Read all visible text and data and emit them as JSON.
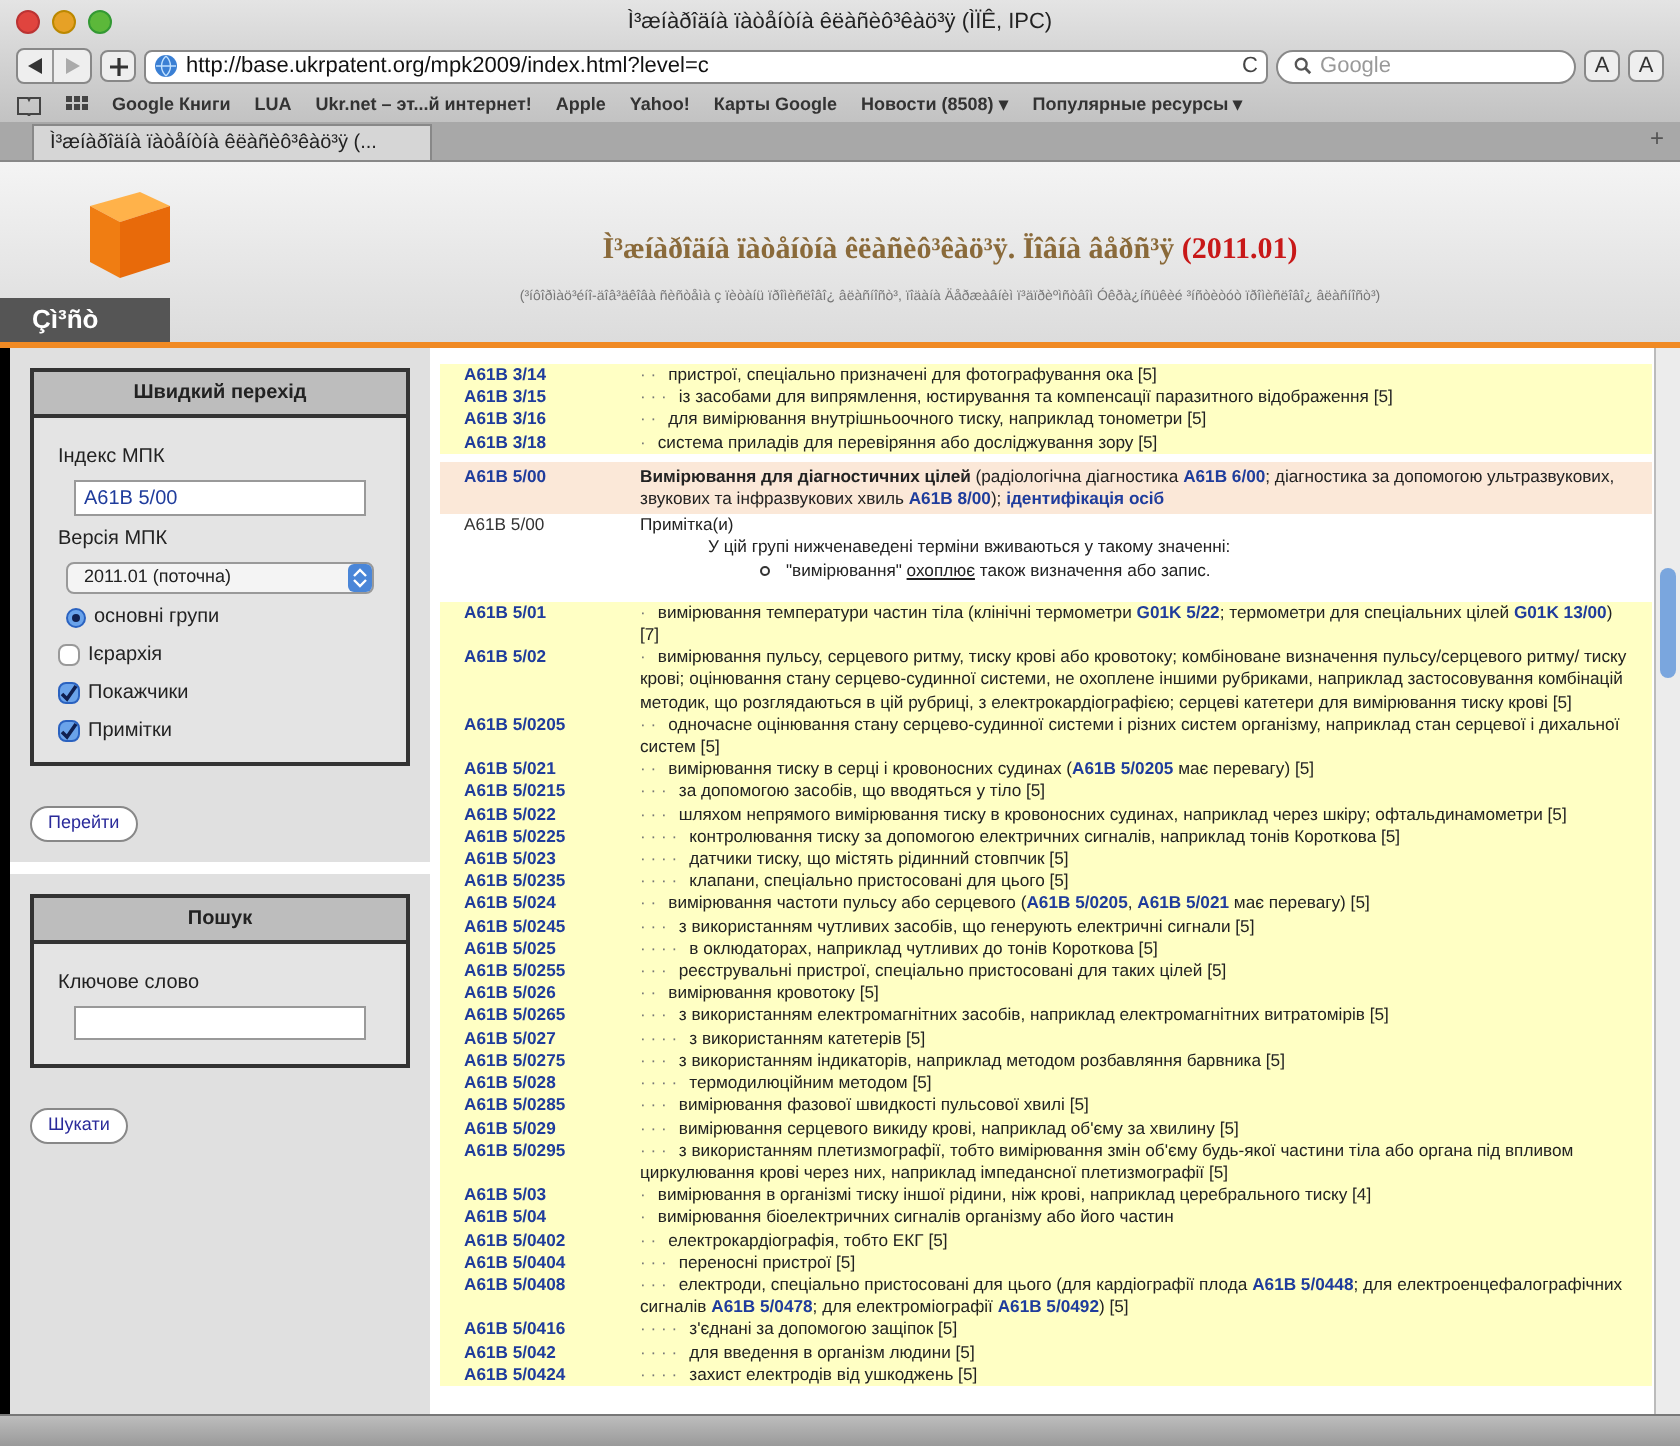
{
  "window": {
    "title": "Ì³æíàðîäíà ïàòåíòíà êëàñèô³êàö³ÿ (ÌÏÊ, IPC)"
  },
  "toolbar": {
    "url": "http://base.ukrpatent.org/mpk2009/index.html?level=c",
    "reload": "C",
    "search_placeholder": "Google",
    "text_buttons": [
      "A",
      "A"
    ]
  },
  "bookmarks": [
    "Google Книги",
    "LUA",
    "Ukr.net – эт...й интернет!",
    "Apple",
    "Yahoo!",
    "Карты Google",
    "Новости (8508) ▾",
    "Популярные ресурсы ▾"
  ],
  "tabs": [
    {
      "label": "Ì³æíàðîäíà ïàòåíòíà êëàñèô³êàö³ÿ (...",
      "selected": true
    }
  ],
  "new_tab": "+",
  "header": {
    "logo_label": "Çì³ñò",
    "title": "Ì³æíàðîäíà ïàòåíòíà êëàñèô³êàö³ÿ. Ïîâíà âåðñ³ÿ",
    "edition": "(2011.01)",
    "subtitle": "(³íôîðìàö³éíî-äîâ³äêîâà ñèñòåìà ç ïèòàíü ïðîìèñëîâî¿ âëàñíîñò³, ïîäàíà Äåðæàâíèì ï³äïðèºìñòâîì Óêðà¿íñüêèé ³íñòèòóò ïðîìèñëîâî¿ âëàñíîñò³)"
  },
  "quick_nav": {
    "title": "Швидкий перехід",
    "index_label": "Індекс МПК",
    "index_value": "A61B 5/00",
    "version_label": "Версія МПК",
    "version_value": "2011.01 (поточна)",
    "options": [
      {
        "kind": "radio",
        "label": "основні групи",
        "checked": true
      },
      {
        "kind": "checkbox",
        "label": "Ієрархія",
        "checked": false
      },
      {
        "kind": "checkbox",
        "label": "Покажчики",
        "checked": true
      },
      {
        "kind": "checkbox",
        "label": "Примітки",
        "checked": true
      }
    ],
    "button": "Перейти"
  },
  "search": {
    "title": "Пошук",
    "label": "Ключове слово",
    "button": "Шукати"
  },
  "rows": [
    {
      "kind": "entry",
      "code": "A61B 3/14",
      "dots": "· ·",
      "text": "пристрої, спеціально призначені для фотографування ока [5]"
    },
    {
      "kind": "entry",
      "code": "A61B 3/15",
      "dots": "· · ·",
      "text": "із засобами для випрямлення, юстирування та компенсації паразитного відображення [5]"
    },
    {
      "kind": "entry",
      "code": "A61B 3/16",
      "dots": "· ·",
      "text": "для вимірювання внутрішньоочного тиску, наприклад тонометри [5]"
    },
    {
      "kind": "entry",
      "code": "A61B 3/18",
      "dots": "·",
      "text": "система приладів для перевіряння або досліджування зору [5]"
    },
    {
      "kind": "main",
      "code": "A61B 5/00",
      "title": "Вимірювання для діагностичних цілей",
      "text": " (радіологічна діагностика **A61B 6/00**; діагностика за допомогою ультразвукових, звукових та інфразвукових хвиль **A61B 8/00**); **ідентифікація осіб**"
    },
    {
      "kind": "note",
      "code": "A61B 5/00",
      "heading": "Примітка(и)",
      "line": "У цій групі нижченаведені терміни вживаються у такому значенні:",
      "term": "\"вимірювання\"",
      "verb": "охоплює",
      "rest": "також визначення або запис."
    },
    {
      "kind": "entry",
      "code": "A61B 5/01",
      "dots": "·",
      "text": "вимірювання температури частин тіла (клінічні термометри **G01K 5/22**; термометри для спеціальних цілей **G01K 13/00**) [7]"
    },
    {
      "kind": "entry",
      "code": "A61B 5/02",
      "dots": "·",
      "text": "вимірювання пульсу, серцевого ритму, тиску крові або кровотоку; комбіноване визначення пульсу/серцевого ритму/ тиску крові; оцінювання стану серцево-судинної системи, не охоплене іншими рубриками, наприклад застосовування комбінацій методик, що розглядаються в цій рубриці, з електрокардіографією; серцеві катетери для вимірювання тиску крові [5]"
    },
    {
      "kind": "entry",
      "code": "A61B 5/0205",
      "dots": "· ·",
      "text": "одночасне оцінювання стану серцево-судинної системи і різних систем організму, наприклад стан серцевої і дихальної систем [5]"
    },
    {
      "kind": "entry",
      "code": "A61B 5/021",
      "dots": "· ·",
      "text": "вимірювання тиску в серці і кровоносних судинах (**A61B 5/0205** має перевагу) [5]"
    },
    {
      "kind": "entry",
      "code": "A61B 5/0215",
      "dots": "· · ·",
      "text": "за допомогою засобів, що вводяться у тіло [5]"
    },
    {
      "kind": "entry",
      "code": "A61B 5/022",
      "dots": "· · ·",
      "text": "шляхом непрямого вимірювання тиску в кровоносних судинах, наприклад через шкіру; офтальдинамометри [5]"
    },
    {
      "kind": "entry",
      "code": "A61B 5/0225",
      "dots": "· · · ·",
      "text": "контролювання тиску за допомогою електричних сигналів, наприклад тонів Короткова [5]"
    },
    {
      "kind": "entry",
      "code": "A61B 5/023",
      "dots": "· · · ·",
      "text": "датчики тиску, що містять рідинний стовпчик [5]"
    },
    {
      "kind": "entry",
      "code": "A61B 5/0235",
      "dots": "· · · ·",
      "text": "клапани, спеціально пристосовані для цього [5]"
    },
    {
      "kind": "entry",
      "code": "A61B 5/024",
      "dots": "· ·",
      "text": "вимірювання частоти пульсу або серцевого (**A61B 5/0205**, **A61B 5/021** має перевагу) [5]"
    },
    {
      "kind": "entry",
      "code": "A61B 5/0245",
      "dots": "· · ·",
      "text": "з використанням чутливих засобів, що генерують електричні сигнали [5]"
    },
    {
      "kind": "entry",
      "code": "A61B 5/025",
      "dots": "· · · ·",
      "text": "в оклюдаторах, наприклад чутливих до тонів Короткова [5]"
    },
    {
      "kind": "entry",
      "code": "A61B 5/0255",
      "dots": "· · ·",
      "text": "реєструвальні пристрої, спеціально пристосовані для таких цілей [5]"
    },
    {
      "kind": "entry",
      "code": "A61B 5/026",
      "dots": "· ·",
      "text": "вимірювання кровотоку [5]"
    },
    {
      "kind": "entry",
      "code": "A61B 5/0265",
      "dots": "· · ·",
      "text": "з використанням електромагнітних засобів, наприклад електромагнітних витратомірів [5]"
    },
    {
      "kind": "entry",
      "code": "A61B 5/027",
      "dots": "· · · ·",
      "text": "з використанням катетерів [5]"
    },
    {
      "kind": "entry",
      "code": "A61B 5/0275",
      "dots": "· · ·",
      "text": "з використанням індикаторів, наприклад методом розбавляння барвника [5]"
    },
    {
      "kind": "entry",
      "code": "A61B 5/028",
      "dots": "· · · ·",
      "text": "термодилюційним методом [5]"
    },
    {
      "kind": "entry",
      "code": "A61B 5/0285",
      "dots": "· · ·",
      "text": "вимірювання фазової швидкості пульсової хвилі [5]"
    },
    {
      "kind": "entry",
      "code": "A61B 5/029",
      "dots": "· · ·",
      "text": "вимірювання серцевого викиду крові, наприклад об'єму за хвилину [5]"
    },
    {
      "kind": "entry",
      "code": "A61B 5/0295",
      "dots": "· · ·",
      "text": "з використанням плетизмографії, тобто вимірювання змін об'єму будь-якої частини тіла або органа під впливом циркулювання крові через них, наприклад імпедансної плетизмографії [5]"
    },
    {
      "kind": "entry",
      "code": "A61B 5/03",
      "dots": "·",
      "text": "вимірювання в організмі тиску іншої рідини, ніж крові, наприклад церебрального тиску [4]"
    },
    {
      "kind": "entry",
      "code": "A61B 5/04",
      "dots": "·",
      "text": "вимірювання біоелектричних сигналів організму або його частин"
    },
    {
      "kind": "entry",
      "code": "A61B 5/0402",
      "dots": "· ·",
      "text": "електрокардіографія, тобто ЕКГ [5]"
    },
    {
      "kind": "entry",
      "code": "A61B 5/0404",
      "dots": "· · ·",
      "text": "переносні пристрої [5]"
    },
    {
      "kind": "entry",
      "code": "A61B 5/0408",
      "dots": "· · ·",
      "text": "електроди, спеціально пристосовані для цього (для кардіографії плода **A61B 5/0448**; для електроенцефалографічних сигналів **A61B 5/0478**; для електроміографії **A61B 5/0492**) [5]"
    },
    {
      "kind": "entry",
      "code": "A61B 5/0416",
      "dots": "· · · ·",
      "text": "з'єднані за допомогою защіпок [5]"
    },
    {
      "kind": "entry",
      "code": "A61B 5/042",
      "dots": "· · · ·",
      "text": "для введення в організм людини [5]"
    },
    {
      "kind": "entry",
      "code": "A61B 5/0424",
      "dots": "· · · ·",
      "text": "захист електродів від ушкоджень [5]"
    }
  ]
}
